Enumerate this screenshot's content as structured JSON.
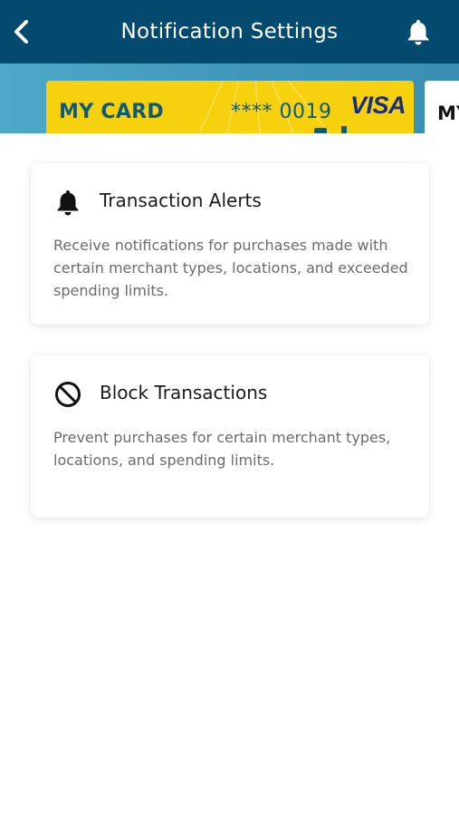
{
  "header": {
    "title": "Notification Settings",
    "back_icon": "chevron-left-icon",
    "bell_icon": "bell-icon",
    "background": "#034a6e"
  },
  "cards": [
    {
      "name": "MY CARD",
      "number": "**** 0019",
      "brand": "VISA",
      "color": "#f7d00e"
    },
    {
      "name": "MY"
    }
  ],
  "options": [
    {
      "icon": "bell-icon",
      "title": "Transaction Alerts",
      "description": "Receive notifications for purchases made with certain merchant types, locations, and exceeded spending limits."
    },
    {
      "icon": "block-icon",
      "title": "Block Transactions",
      "description": "Prevent purchases for certain merchant types, locations, and spending limits."
    }
  ]
}
